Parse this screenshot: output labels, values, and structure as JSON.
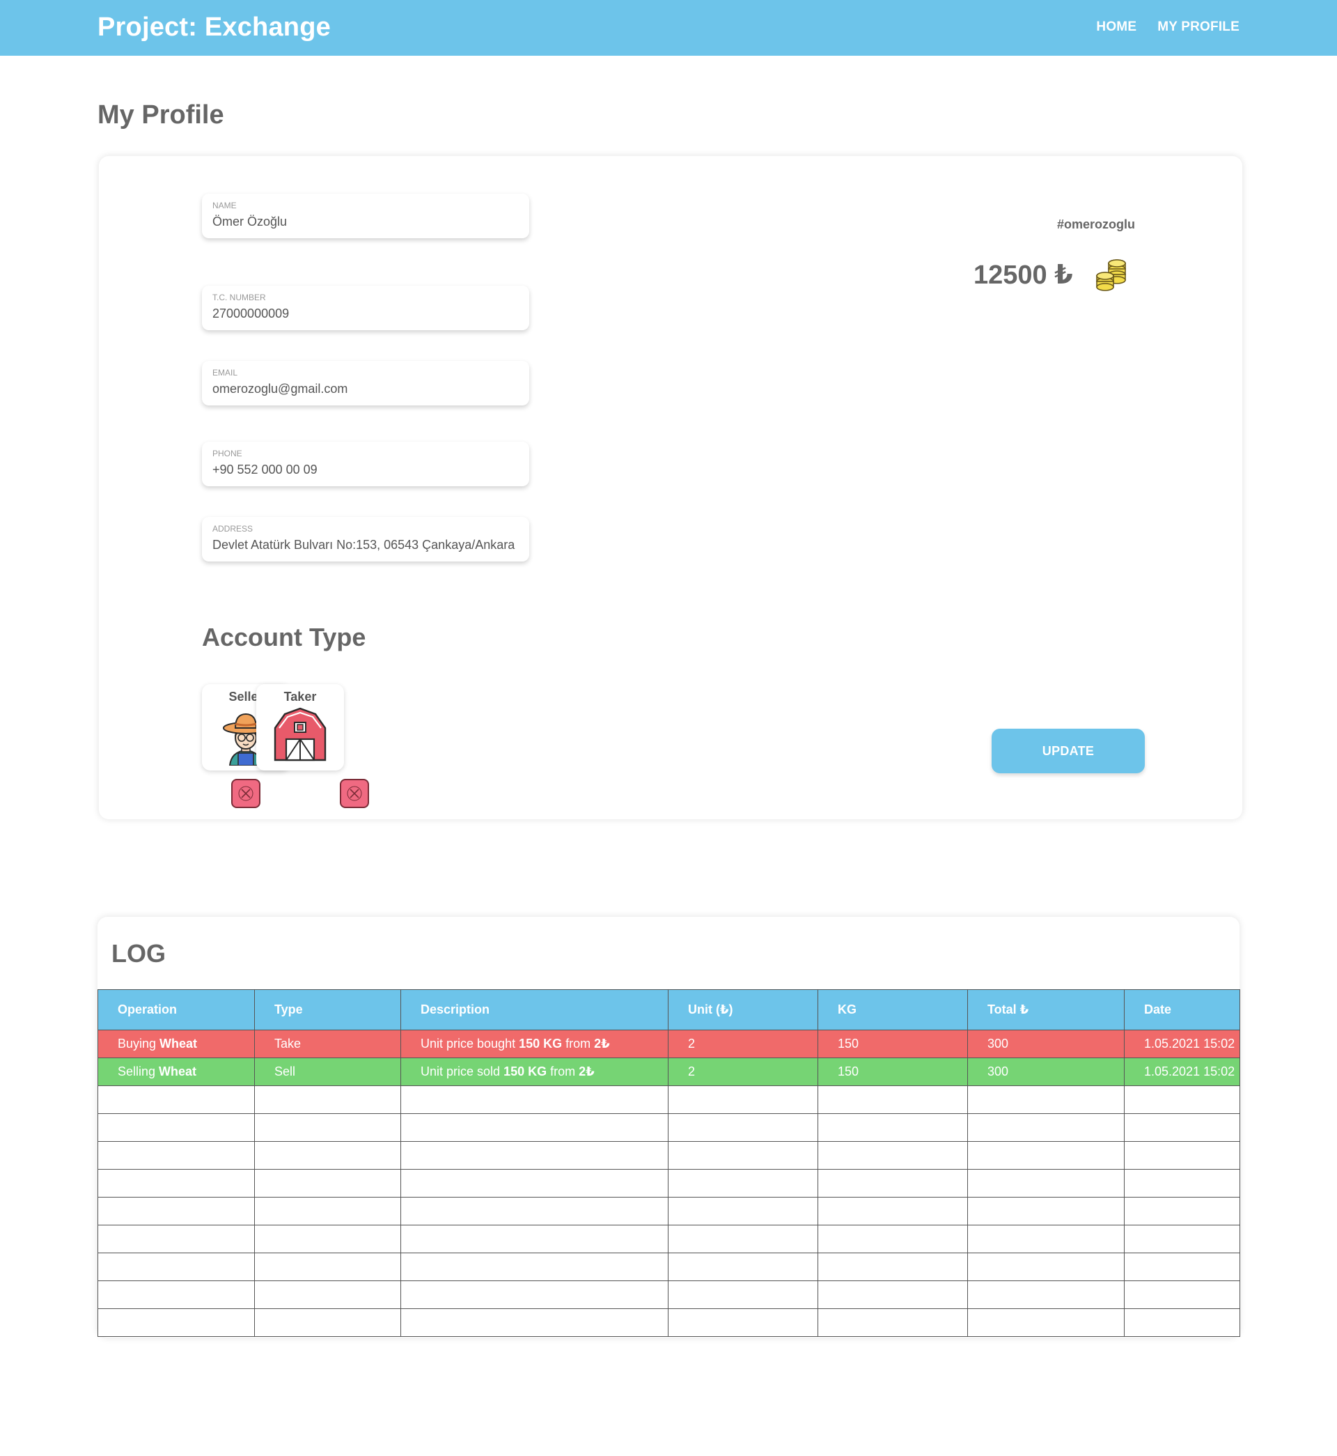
{
  "header": {
    "brand": "Project: Exchange",
    "nav": [
      {
        "label": "HOME"
      },
      {
        "label": "MY PROFILE"
      }
    ]
  },
  "page_title": "My Profile",
  "profile": {
    "fields": [
      {
        "label": "NAME",
        "value": "Ömer Özoğlu"
      },
      {
        "label": "T.C. NUMBER",
        "value": "27000000009"
      },
      {
        "label": "EMAIL",
        "value": "omerozoglu@gmail.com"
      },
      {
        "label": "PHONE",
        "value": "+90 552 000 00 09"
      },
      {
        "label": "ADDRESS",
        "value": "Devlet Atatürk Bulvarı No:153, 06543 Çankaya/Ankara"
      }
    ],
    "username": "#omerozoglu",
    "balance": "12500 ₺",
    "account_type_title": "Account Type",
    "account_types": [
      {
        "label": "Seller",
        "icon": "farmer-icon",
        "selected": false
      },
      {
        "label": "Taker",
        "icon": "barn-icon",
        "selected": false
      }
    ],
    "update_label": "UPDATE"
  },
  "log": {
    "title": "LOG",
    "columns": [
      "Operation",
      "Type",
      "Description",
      "Unit (₺)",
      "KG",
      "Total ₺",
      "Date"
    ],
    "rows": [
      {
        "kind": "take",
        "operation_prefix": "Buying ",
        "operation_item": "Wheat",
        "type": "Take",
        "desc_prefix": "Unit price bought ",
        "desc_qty": "150 KG",
        "desc_mid": " from ",
        "desc_price": "2₺",
        "unit": "2",
        "kg": "150",
        "total": "300",
        "date": "1.05.2021 15:02"
      },
      {
        "kind": "sell",
        "operation_prefix": "Selling ",
        "operation_item": "Wheat",
        "type": "Sell",
        "desc_prefix": "Unit price sold ",
        "desc_qty": "150 KG",
        "desc_mid": " from ",
        "desc_price": "2₺",
        "unit": "2",
        "kg": "150",
        "total": "300",
        "date": "1.05.2021 15:02"
      }
    ],
    "empty_rows": 9
  },
  "colors": {
    "primary": "#6dc4ea",
    "take_row": "#f06a6a",
    "sell_row": "#76d474",
    "close_button": "#f06a82"
  }
}
